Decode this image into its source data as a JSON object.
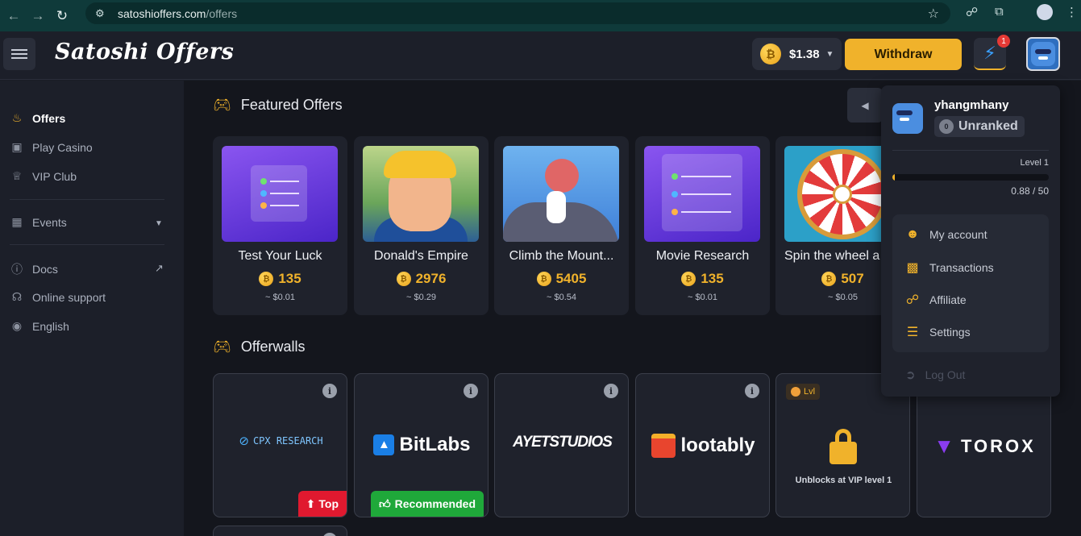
{
  "browser": {
    "url_host": "satoshioffers.com",
    "url_path": "/offers"
  },
  "header": {
    "logo": "Satoshi Offers",
    "balance": "$1.38",
    "withdraw_label": "Withdraw",
    "notification_count": "1"
  },
  "sidebar": {
    "items": [
      {
        "label": "Offers",
        "icon": "flame-icon"
      },
      {
        "label": "Play Casino",
        "icon": "casino-icon"
      },
      {
        "label": "VIP Club",
        "icon": "crown-icon"
      },
      {
        "label": "Events",
        "icon": "calendar-icon"
      },
      {
        "label": "Docs",
        "icon": "info-icon"
      },
      {
        "label": "Online support",
        "icon": "headset-icon"
      },
      {
        "label": "English",
        "icon": "globe-icon"
      }
    ]
  },
  "featured": {
    "title": "Featured Offers",
    "offers": [
      {
        "name": "Test Your Luck",
        "points": "135",
        "usd": "~ $0.01"
      },
      {
        "name": "Donald's Empire",
        "points": "2976",
        "usd": "~ $0.29"
      },
      {
        "name": "Climb the Mount...",
        "points": "5405",
        "usd": "~ $0.54"
      },
      {
        "name": "Movie Research",
        "points": "135",
        "usd": "~ $0.01"
      },
      {
        "name": "Spin the wheel a",
        "points": "507",
        "usd": "~ $0.05"
      }
    ]
  },
  "offerwalls": {
    "title": "Offerwalls",
    "walls": [
      {
        "name": "CPX RESEARCH",
        "tag": "Top"
      },
      {
        "name": "BitLabs",
        "tag": "Recommended"
      },
      {
        "name": "AYETSTUDIOS",
        "tag": ""
      },
      {
        "name": "lootably",
        "tag": ""
      },
      {
        "name": "",
        "badge": "Lvl",
        "locked_text": "Unblocks at VIP level 1"
      },
      {
        "name": "TOROX",
        "tag": ""
      }
    ]
  },
  "profile": {
    "username": "yhangmhany",
    "rank": "Unranked",
    "rank_number": "0",
    "level": "Level 1",
    "xp": "0.88 / 50",
    "xp_progress": 0.0176,
    "menu": [
      {
        "label": "My account",
        "icon": "user-icon"
      },
      {
        "label": "Transactions",
        "icon": "wallet-icon"
      },
      {
        "label": "Affiliate",
        "icon": "share-icon"
      },
      {
        "label": "Settings",
        "icon": "sliders-icon"
      }
    ],
    "logout": "Log Out"
  },
  "colors": {
    "accent": "#f0b22b",
    "background": "#14161d",
    "sidebar": "#1c1f29",
    "card": "#1f222c",
    "tag_top": "#e0192f",
    "tag_recommended": "#1fa83a"
  }
}
